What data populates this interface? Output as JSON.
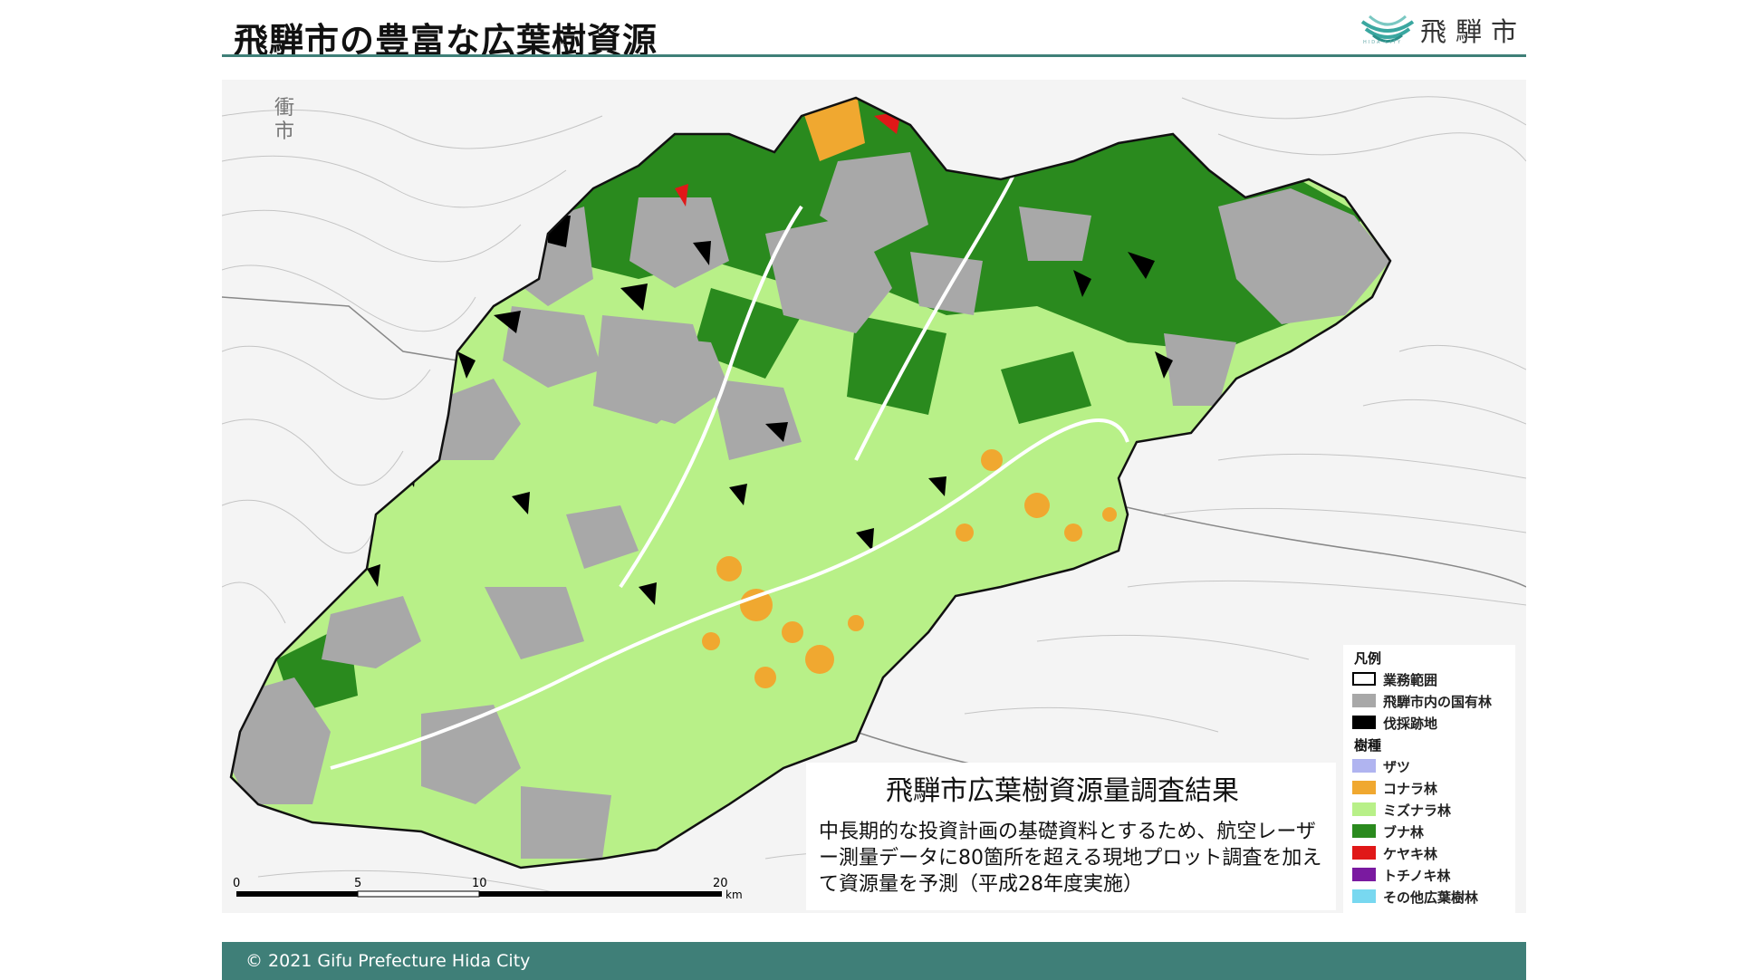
{
  "header": {
    "title": "飛騨市の豊富な広葉樹資源",
    "logo_text": "飛騨市",
    "logo_subtext": "HIDA CITY"
  },
  "map": {
    "place_labels": [
      "衝",
      "市"
    ],
    "scale_bar": {
      "ticks": [
        "0",
        "5",
        "10",
        "20"
      ],
      "unit": "km"
    },
    "info_box": {
      "title": "飛騨市広葉樹資源量調査結果",
      "body": "中長期的な投資計画の基礎資料とするため、航空レーザー測量データに80箇所を超える現地プロット調査を加えて資源量を予測（平成28年度実施）"
    },
    "legend": {
      "title": "凡例",
      "area_items": [
        {
          "label": "業務範囲",
          "color": "#ffffff"
        },
        {
          "label": "飛騨市内の国有林",
          "color": "#a8a8a8"
        },
        {
          "label": "伐採跡地",
          "color": "#000000"
        }
      ],
      "species_title": "樹種",
      "species_items": [
        {
          "label": "ザツ",
          "color": "#b0b4f0"
        },
        {
          "label": "コナラ林",
          "color": "#f0a830"
        },
        {
          "label": "ミズナラ林",
          "color": "#b8f088"
        },
        {
          "label": "ブナ林",
          "color": "#2a8a1e"
        },
        {
          "label": "ケヤキ林",
          "color": "#e01818"
        },
        {
          "label": "トチノキ林",
          "color": "#7a1aa0"
        },
        {
          "label": "その他広葉樹林",
          "color": "#78d8f0"
        }
      ]
    },
    "colors": {
      "national_forest": "#a8a8a8",
      "mizunara": "#b8f088",
      "buna": "#2a8a1e",
      "konara": "#f0a830",
      "keyaki": "#e01818",
      "clearcut": "#000000",
      "background_map": "#f4f4f4"
    }
  },
  "footer": {
    "copyright": "© 2021 Gifu Prefecture Hida City",
    "color": "#3f7f78"
  }
}
